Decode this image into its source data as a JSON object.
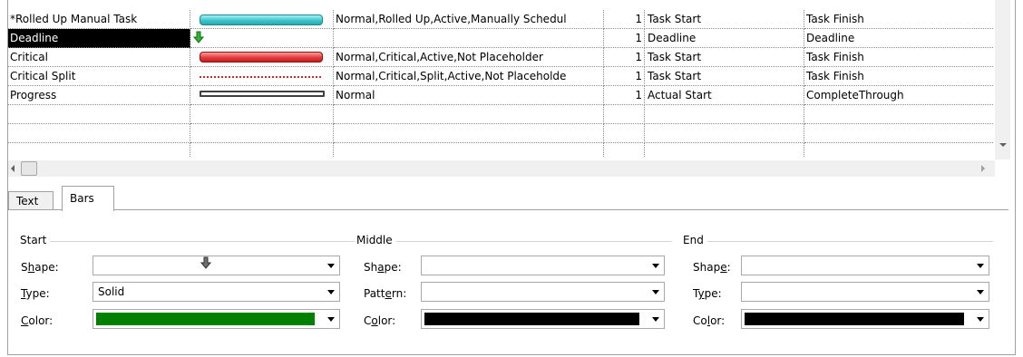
{
  "rows": [
    {
      "name": "*Rolled Up Manual Task",
      "appearance": "teal",
      "show_for": "Normal,Rolled Up,Active,Manually Schedul",
      "row": "1",
      "from": "Task Start",
      "to": "Task Finish"
    },
    {
      "name": "Deadline",
      "appearance": "deadline",
      "show_for": "",
      "row": "1",
      "from": "Deadline",
      "to": "Deadline"
    },
    {
      "name": "Critical",
      "appearance": "red",
      "show_for": "Normal,Critical,Active,Not Placeholder",
      "row": "1",
      "from": "Task Start",
      "to": "Task Finish"
    },
    {
      "name": "Critical Split",
      "appearance": "dotted",
      "show_for": "Normal,Critical,Split,Active,Not Placeholde",
      "row": "1",
      "from": "Task Start",
      "to": "Task Finish"
    },
    {
      "name": "Progress",
      "appearance": "progress",
      "show_for": "Normal",
      "row": "1",
      "from": "Actual Start",
      "to": "CompleteThrough"
    }
  ],
  "tabs": {
    "text": "Text",
    "bars": "Bars"
  },
  "start": {
    "title": "Start",
    "shape_label_pre": "S",
    "shape_label_u": "h",
    "shape_label_post": "ape:",
    "type_label_pre": "",
    "type_label_u": "T",
    "type_label_post": "ype:",
    "color_label_pre": "",
    "color_label_u": "C",
    "color_label_post": "olor:",
    "type_value": "Solid",
    "color_value": "#008000"
  },
  "middle": {
    "title": "Middle",
    "shape_label_pre": "Sh",
    "shape_label_u": "a",
    "shape_label_post": "pe:",
    "pattern_label_pre": "Patt",
    "pattern_label_u": "e",
    "pattern_label_post": "rn:",
    "color_label_pre": "C",
    "color_label_u": "o",
    "color_label_post": "lor:",
    "color_value": "#000000"
  },
  "end": {
    "title": "End",
    "shape_label_pre": "Shap",
    "shape_label_u": "e",
    "shape_label_post": ":",
    "type_label_pre": "T",
    "type_label_u": "y",
    "type_label_post": "pe:",
    "color_label_pre": "Co",
    "color_label_u": "l",
    "color_label_post": "or:",
    "color_value": "#000000"
  },
  "colors": {
    "selected_bg": "#000000",
    "teal": "#3cc6cc",
    "red": "#e53b3b",
    "green": "#008000"
  }
}
